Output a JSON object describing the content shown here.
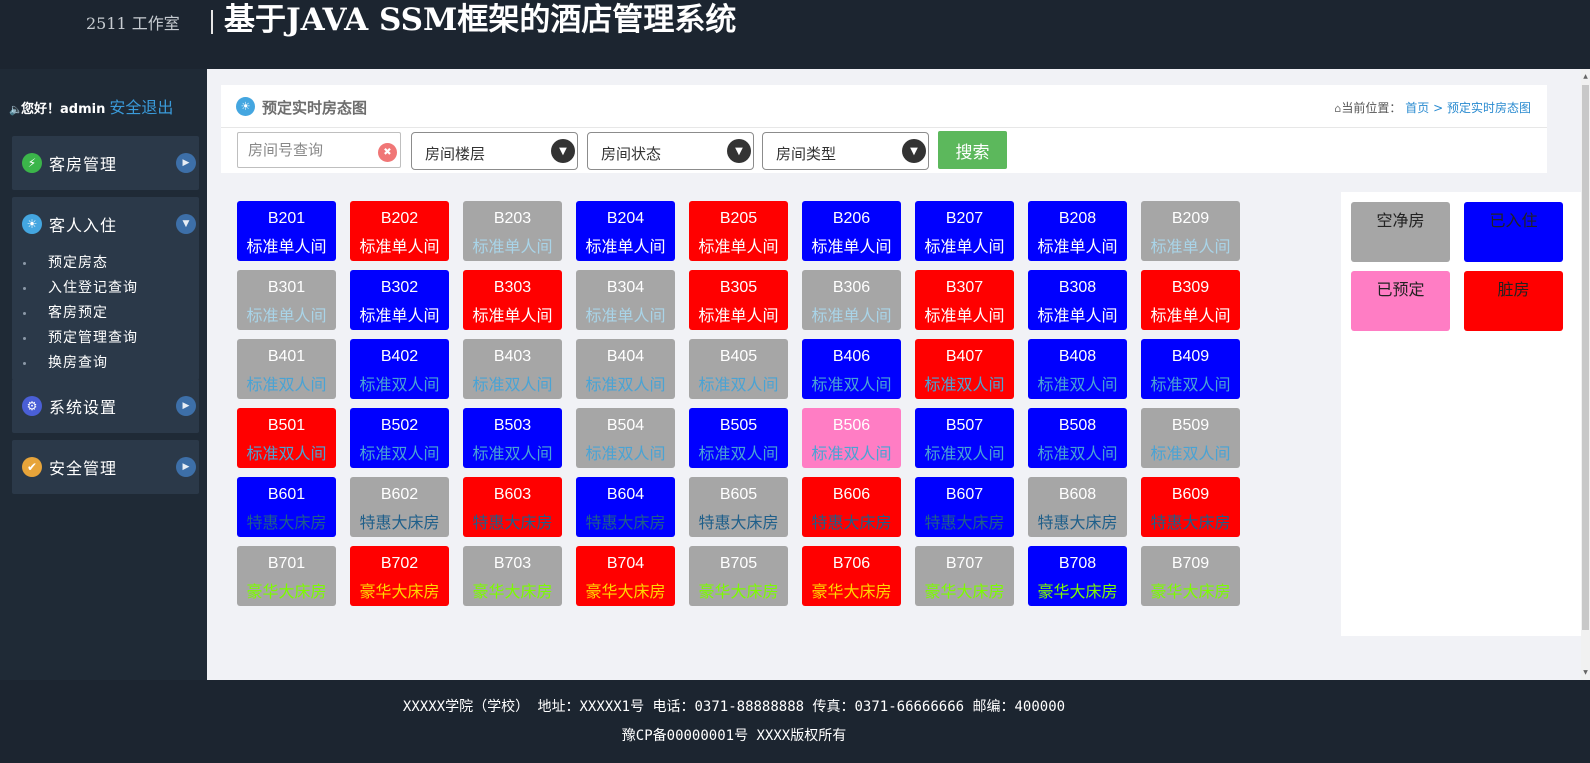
{
  "header": {
    "studio": "2511 工作室",
    "title": "基于JAVA SSM框架的酒店管理系统"
  },
  "sidebar": {
    "welcome_text": "您好！admin",
    "logout": "安全退出",
    "menus": [
      {
        "label": "客房管理",
        "icon": "bolt-icon",
        "expanded": false
      },
      {
        "label": "客人入住",
        "icon": "lightbulb-icon",
        "expanded": true,
        "items": [
          "预定房态",
          "入住登记查询",
          "客房预定",
          "预定管理查询",
          "换房查询"
        ]
      },
      {
        "label": "系统设置",
        "icon": "gears-icon",
        "expanded": false
      },
      {
        "label": "安全管理",
        "icon": "shield-icon",
        "expanded": false
      }
    ]
  },
  "panel": {
    "title": "预定实时房态图",
    "breadcrumb_prefix": "当前位置：",
    "breadcrumb_home": "首页",
    "breadcrumb_sep": ">",
    "breadcrumb_current": "预定实时房态图"
  },
  "filters": {
    "room_no_placeholder": "房间号查询",
    "floor": "房间楼层",
    "status": "房间状态",
    "type": "房间类型",
    "search": "搜索"
  },
  "colors": {
    "vacant": "#a6a6a6",
    "occupied": "#0000ff",
    "reserved": "#ff7dc4",
    "dirty": "#ff0000",
    "accent_green": "#5cb85c",
    "header_bg": "#1c2530"
  },
  "rooms": [
    {
      "floor": 2,
      "rooms": [
        {
          "no": "B201",
          "type": "标准单人间",
          "status": "occupied"
        },
        {
          "no": "B202",
          "type": "标准单人间",
          "status": "dirty"
        },
        {
          "no": "B203",
          "type": "标准单人间",
          "status": "vacant"
        },
        {
          "no": "B204",
          "type": "标准单人间",
          "status": "occupied"
        },
        {
          "no": "B205",
          "type": "标准单人间",
          "status": "dirty"
        },
        {
          "no": "B206",
          "type": "标准单人间",
          "status": "occupied"
        },
        {
          "no": "B207",
          "type": "标准单人间",
          "status": "occupied"
        },
        {
          "no": "B208",
          "type": "标准单人间",
          "status": "occupied"
        },
        {
          "no": "B209",
          "type": "标准单人间",
          "status": "vacant"
        }
      ]
    },
    {
      "floor": 3,
      "rooms": [
        {
          "no": "B301",
          "type": "标准单人间",
          "status": "vacant"
        },
        {
          "no": "B302",
          "type": "标准单人间",
          "status": "occupied"
        },
        {
          "no": "B303",
          "type": "标准单人间",
          "status": "dirty"
        },
        {
          "no": "B304",
          "type": "标准单人间",
          "status": "vacant"
        },
        {
          "no": "B305",
          "type": "标准单人间",
          "status": "dirty"
        },
        {
          "no": "B306",
          "type": "标准单人间",
          "status": "vacant"
        },
        {
          "no": "B307",
          "type": "标准单人间",
          "status": "dirty"
        },
        {
          "no": "B308",
          "type": "标准单人间",
          "status": "occupied"
        },
        {
          "no": "B309",
          "type": "标准单人间",
          "status": "dirty"
        }
      ]
    },
    {
      "floor": 4,
      "rooms": [
        {
          "no": "B401",
          "type": "标准双人间",
          "status": "vacant"
        },
        {
          "no": "B402",
          "type": "标准双人间",
          "status": "occupied"
        },
        {
          "no": "B403",
          "type": "标准双人间",
          "status": "vacant"
        },
        {
          "no": "B404",
          "type": "标准双人间",
          "status": "vacant"
        },
        {
          "no": "B405",
          "type": "标准双人间",
          "status": "vacant"
        },
        {
          "no": "B406",
          "type": "标准双人间",
          "status": "occupied"
        },
        {
          "no": "B407",
          "type": "标准双人间",
          "status": "dirty"
        },
        {
          "no": "B408",
          "type": "标准双人间",
          "status": "occupied"
        },
        {
          "no": "B409",
          "type": "标准双人间",
          "status": "occupied"
        }
      ]
    },
    {
      "floor": 5,
      "rooms": [
        {
          "no": "B501",
          "type": "标准双人间",
          "status": "dirty"
        },
        {
          "no": "B502",
          "type": "标准双人间",
          "status": "occupied"
        },
        {
          "no": "B503",
          "type": "标准双人间",
          "status": "occupied"
        },
        {
          "no": "B504",
          "type": "标准双人间",
          "status": "vacant"
        },
        {
          "no": "B505",
          "type": "标准双人间",
          "status": "occupied"
        },
        {
          "no": "B506",
          "type": "标准双人间",
          "status": "reserved"
        },
        {
          "no": "B507",
          "type": "标准双人间",
          "status": "occupied"
        },
        {
          "no": "B508",
          "type": "标准双人间",
          "status": "occupied"
        },
        {
          "no": "B509",
          "type": "标准双人间",
          "status": "vacant"
        }
      ]
    },
    {
      "floor": 6,
      "rooms": [
        {
          "no": "B601",
          "type": "特惠大床房",
          "status": "occupied"
        },
        {
          "no": "B602",
          "type": "特惠大床房",
          "status": "vacant"
        },
        {
          "no": "B603",
          "type": "特惠大床房",
          "status": "dirty"
        },
        {
          "no": "B604",
          "type": "特惠大床房",
          "status": "occupied"
        },
        {
          "no": "B605",
          "type": "特惠大床房",
          "status": "vacant"
        },
        {
          "no": "B606",
          "type": "特惠大床房",
          "status": "dirty"
        },
        {
          "no": "B607",
          "type": "特惠大床房",
          "status": "occupied"
        },
        {
          "no": "B608",
          "type": "特惠大床房",
          "status": "vacant"
        },
        {
          "no": "B609",
          "type": "特惠大床房",
          "status": "dirty"
        }
      ]
    },
    {
      "floor": 7,
      "rooms": [
        {
          "no": "B701",
          "type": "豪华大床房",
          "status": "vacant"
        },
        {
          "no": "B702",
          "type": "豪华大床房",
          "status": "dirty"
        },
        {
          "no": "B703",
          "type": "豪华大床房",
          "status": "vacant"
        },
        {
          "no": "B704",
          "type": "豪华大床房",
          "status": "dirty"
        },
        {
          "no": "B705",
          "type": "豪华大床房",
          "status": "vacant"
        },
        {
          "no": "B706",
          "type": "豪华大床房",
          "status": "dirty"
        },
        {
          "no": "B707",
          "type": "豪华大床房",
          "status": "vacant"
        },
        {
          "no": "B708",
          "type": "豪华大床房",
          "status": "occupied"
        },
        {
          "no": "B709",
          "type": "豪华大床房",
          "status": "vacant"
        }
      ]
    }
  ],
  "legend": [
    {
      "label": "空净房",
      "status": "vacant"
    },
    {
      "label": "已入住",
      "status": "occupied"
    },
    {
      "label": "已预定",
      "status": "reserved"
    },
    {
      "label": "脏房",
      "status": "dirty"
    }
  ],
  "footer": {
    "line1": "XXXXX学院（学校） 地址：XXXXX1号 电话：0371-88888888 传真：0371-66666666 邮编：400000",
    "line2": "豫CP备00000001号 XXXX版权所有"
  }
}
